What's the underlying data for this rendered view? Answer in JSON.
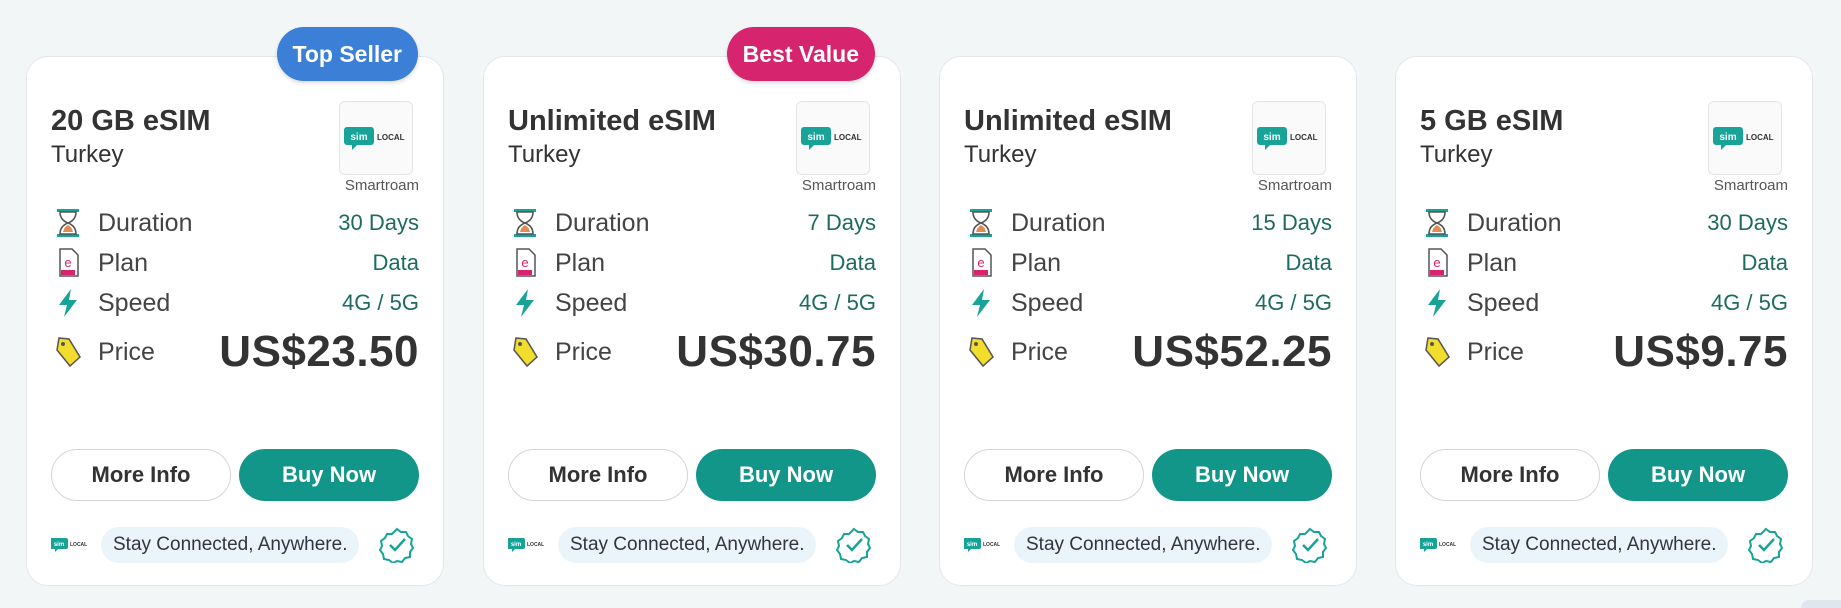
{
  "colors": {
    "accent": "#13968a",
    "top_seller": "#3b7fd6",
    "best_value": "#d6256e",
    "value_text": "#1d6b5f"
  },
  "labels": {
    "duration": "Duration",
    "plan": "Plan",
    "speed": "Speed",
    "price": "Price",
    "more_info": "More Info",
    "buy_now": "Buy Now",
    "tagline": "Stay Connected, Anywhere.",
    "logo_sim": "sim",
    "logo_local": "LOCAL"
  },
  "icons": {
    "duration": "hourglass-icon",
    "plan": "esim-card-icon",
    "speed": "lightning-icon",
    "price": "price-tag-icon",
    "verified": "verified-badge-icon"
  },
  "cards": [
    {
      "badge": "Top Seller",
      "title": "20 GB eSIM",
      "country": "Turkey",
      "provider": "Smartroam",
      "duration": "30 Days",
      "plan": "Data",
      "speed": "4G / 5G",
      "price": "US$23.50"
    },
    {
      "badge": "Best Value",
      "title": "Unlimited eSIM",
      "country": "Turkey",
      "provider": "Smartroam",
      "duration": "7 Days",
      "plan": "Data",
      "speed": "4G / 5G",
      "price": "US$30.75"
    },
    {
      "title": "Unlimited eSIM",
      "country": "Turkey",
      "provider": "Smartroam",
      "duration": "15 Days",
      "plan": "Data",
      "speed": "4G / 5G",
      "price": "US$52.25"
    },
    {
      "title": "5 GB eSIM",
      "country": "Turkey",
      "provider": "Smartroam",
      "duration": "30 Days",
      "plan": "Data",
      "speed": "4G / 5G",
      "price": "US$9.75"
    }
  ]
}
